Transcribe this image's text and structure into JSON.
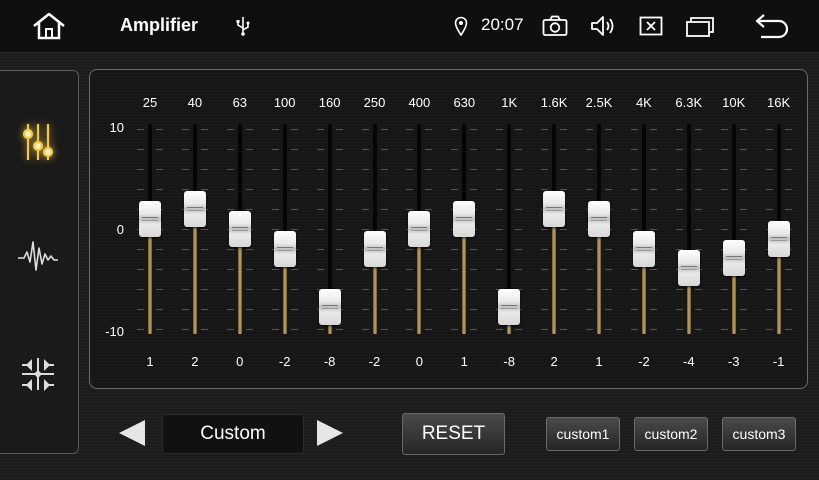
{
  "topbar": {
    "title": "Amplifier",
    "time": "20:07",
    "icons": [
      "home-icon",
      "usb-icon",
      "location-pin-icon",
      "camera-icon",
      "volume-icon",
      "close-window-icon",
      "recent-apps-icon",
      "back-icon"
    ]
  },
  "sidebar": {
    "items": [
      {
        "name": "equalizer",
        "icon": "equalizer-sliders-icon",
        "active": true
      },
      {
        "name": "sound-effect",
        "icon": "waveform-icon",
        "active": false
      },
      {
        "name": "balance-fader",
        "icon": "balance-fader-icon",
        "active": false
      }
    ]
  },
  "equalizer": {
    "scale": {
      "max": "10",
      "mid": "0",
      "min": "-10"
    },
    "range": [
      -10,
      10
    ],
    "bands": [
      {
        "freq": "25",
        "value": 1
      },
      {
        "freq": "40",
        "value": 2
      },
      {
        "freq": "63",
        "value": 0
      },
      {
        "freq": "100",
        "value": -2
      },
      {
        "freq": "160",
        "value": -8
      },
      {
        "freq": "250",
        "value": -2
      },
      {
        "freq": "400",
        "value": 0
      },
      {
        "freq": "630",
        "value": 1
      },
      {
        "freq": "1K",
        "value": -8
      },
      {
        "freq": "1.6K",
        "value": 2
      },
      {
        "freq": "2.5K",
        "value": 1
      },
      {
        "freq": "4K",
        "value": -2
      },
      {
        "freq": "6.3K",
        "value": -4
      },
      {
        "freq": "10K",
        "value": -3
      },
      {
        "freq": "16K",
        "value": -1
      }
    ]
  },
  "controls": {
    "preset": "Custom",
    "reset_label": "RESET",
    "custom_presets": [
      "custom1",
      "custom2",
      "custom3"
    ]
  },
  "colors": {
    "accent": "#f0c040",
    "track_fill": "#c9a867",
    "background": "#1c1c1c"
  }
}
